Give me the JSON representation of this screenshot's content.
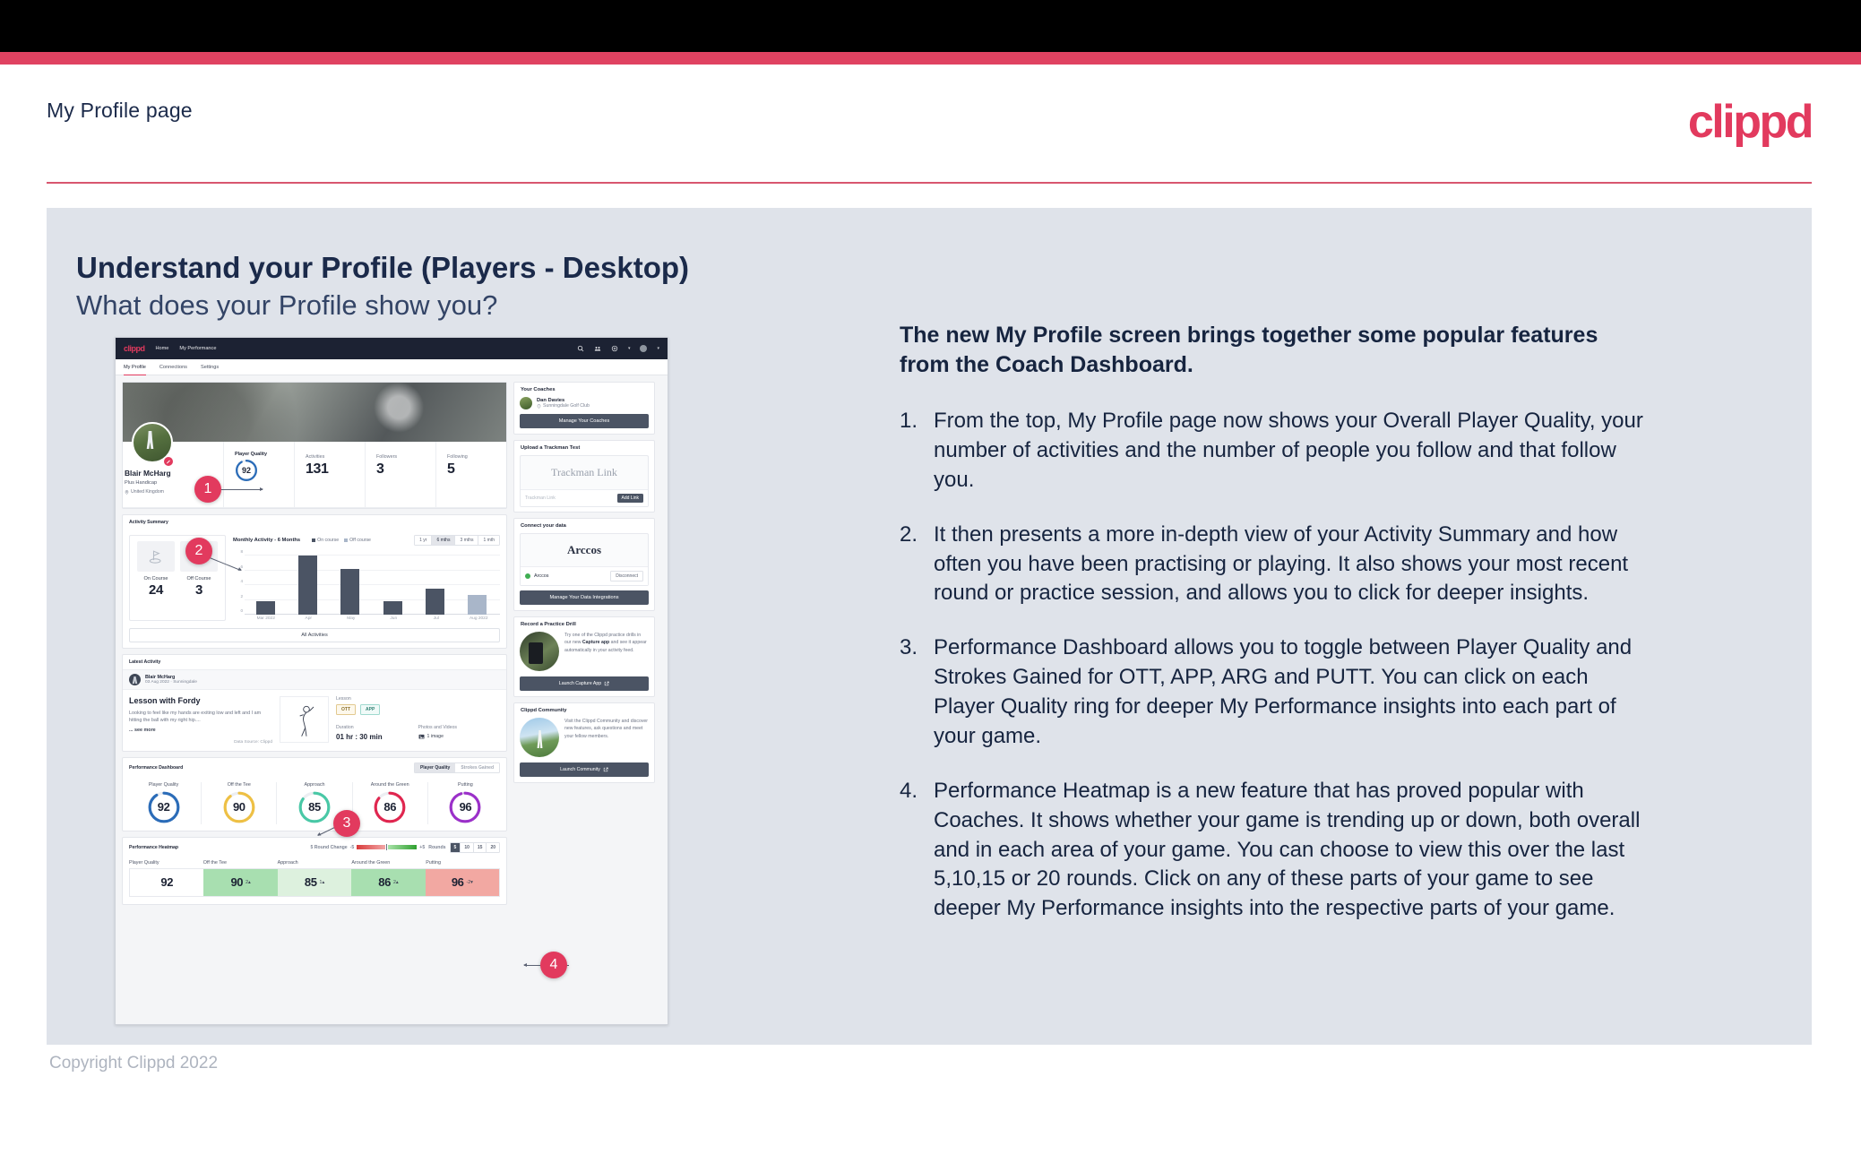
{
  "slide": {
    "kicker": "My Profile page",
    "brand": "clippd",
    "heading": "Understand your Profile (Players - Desktop)",
    "subheading": "What does your Profile show you?",
    "footer": "Copyright Clippd 2022",
    "accent_pink": "#e23a5e",
    "panel_bg": "#dfe3ea",
    "text_navy": "#16243f"
  },
  "copy": {
    "lead": "The new My Profile screen brings together some popular features from the Coach Dashboard.",
    "items": [
      {
        "num": "1.",
        "text": "From the top, My Profile page now shows your Overall Player Quality, your number of activities and the number of people you follow and that follow you."
      },
      {
        "num": "2.",
        "text": "It then presents a more in-depth view of your Activity Summary and how often you have been practising or playing. It also shows your most recent round or practice session, and allows you to click for deeper insights."
      },
      {
        "num": "3.",
        "text": "Performance Dashboard allows you to toggle between Player Quality and Strokes Gained for OTT, APP, ARG and PUTT. You can click on each Player Quality ring for deeper My Performance insights into each part of your game."
      },
      {
        "num": "4.",
        "text": "Performance Heatmap is a new feature that has proved popular with Coaches. It shows whether your game is trending up or down, both overall and in each area of your game. You can choose to view this over the last 5,10,15 or 20 rounds. Click on any of these parts of your game to see deeper My Performance insights into the respective parts of your game."
      }
    ]
  },
  "callouts": [
    {
      "label": "1"
    },
    {
      "label": "2"
    },
    {
      "label": "3"
    },
    {
      "label": "4"
    }
  ],
  "app": {
    "logo": "clippd",
    "nav": [
      {
        "label": "Home"
      },
      {
        "label": "My Performance"
      }
    ],
    "nav_icons": [
      "search-icon",
      "community-icon",
      "add-circle-icon",
      "avatar-icon"
    ],
    "tabs": [
      {
        "label": "My Profile",
        "active": true
      },
      {
        "label": "Connections",
        "active": false
      },
      {
        "label": "Settings",
        "active": false
      }
    ],
    "profile": {
      "name": "Blair McHarg",
      "handicap": "Plus Handicap",
      "location": "United Kingdom",
      "stats": [
        {
          "label": "Player Quality",
          "value": "92",
          "ring": true,
          "color": "#2b6cb8"
        },
        {
          "label": "Activities",
          "value": "131"
        },
        {
          "label": "Followers",
          "value": "3"
        },
        {
          "label": "Following",
          "value": "5"
        }
      ]
    },
    "activity_summary": {
      "title": "Activity Summary",
      "tiles": [
        {
          "label": "On Course",
          "value": "24",
          "icon": "golf-flag-icon"
        },
        {
          "label": "Off Course",
          "value": "3",
          "icon": "monitor-icon"
        }
      ],
      "all_activities_label": "All Activities",
      "range_options": [
        {
          "label": "1 yr",
          "active": false
        },
        {
          "label": "6 mths",
          "active": true
        },
        {
          "label": "3 mths",
          "active": false
        },
        {
          "label": "1 mth",
          "active": false
        }
      ],
      "legend": [
        {
          "label": "On course",
          "color": "#4b5464"
        },
        {
          "label": "Off course",
          "color": "#a9b6c9"
        }
      ]
    },
    "latest_activity": {
      "title": "Latest Activity",
      "user": "Blair McHarg",
      "meta": "03 Aug 2022 · Sunningdale",
      "activity_title": "Lesson with Fordy",
      "description": "Looking to feel like my hands are exiting low and left and I am hitting the ball with my right hip....",
      "see_more": "... see more",
      "data_source": "Data Source: Clippd",
      "type_label": "Lesson",
      "tags": [
        "OTT",
        "APP"
      ],
      "duration_label": "Duration",
      "duration_value": "01 hr : 30 min",
      "media_label": "Photos and Videos",
      "media_value": "1 image"
    },
    "performance_dashboard": {
      "title": "Performance Dashboard",
      "toggle": [
        {
          "label": "Player Quality",
          "active": true
        },
        {
          "label": "Strokes Gained",
          "active": false
        }
      ],
      "rings": [
        {
          "label": "Player Quality",
          "value": "92",
          "color": "#2b6cb8"
        },
        {
          "label": "Off the Tee",
          "value": "90",
          "color": "#eec044"
        },
        {
          "label": "Approach",
          "value": "85",
          "color": "#49c8a6"
        },
        {
          "label": "Around the Green",
          "value": "86",
          "color": "#e0264f"
        },
        {
          "label": "Putting",
          "value": "96",
          "color": "#9b30c9"
        }
      ]
    },
    "performance_heatmap": {
      "title": "Performance Heatmap",
      "change_label": "5 Round Change",
      "scale_min": "-5",
      "scale_max": "+5",
      "rounds_label": "Rounds",
      "rounds_options": [
        {
          "label": "5",
          "active": true
        },
        {
          "label": "10",
          "active": false
        },
        {
          "label": "15",
          "active": false
        },
        {
          "label": "20",
          "active": false
        }
      ],
      "cells": [
        {
          "label": "Player Quality",
          "value": "92",
          "delta": "",
          "dir": "",
          "bg": "#ffffff"
        },
        {
          "label": "Off the Tee",
          "value": "90",
          "delta": "2",
          "dir": "up",
          "bg": "#a8dfb0"
        },
        {
          "label": "Approach",
          "value": "85",
          "delta": "1",
          "dir": "up",
          "bg": "#ddf1de"
        },
        {
          "label": "Around the Green",
          "value": "86",
          "delta": "2",
          "dir": "up",
          "bg": "#a8dfb0"
        },
        {
          "label": "Putting",
          "value": "96",
          "delta": "-2",
          "dir": "down",
          "bg": "#f2a8a2"
        }
      ]
    },
    "sidebar": {
      "coaches": {
        "title": "Your Coaches",
        "coach_name": "Dan Davies",
        "coach_club": "Sunningdale Golf Club",
        "button": "Manage Your Coaches"
      },
      "trackman": {
        "title": "Upload a Trackman Test",
        "brand": "Trackman Link",
        "input_placeholder": "Trackman Link",
        "add_button": "Add Link"
      },
      "connect": {
        "title": "Connect your data",
        "brand": "Arccos",
        "provider": "Arccos",
        "disconnect": "Disconnect",
        "button": "Manage Your Data Integrations"
      },
      "practice": {
        "title": "Record a Practice Drill",
        "body_1": "Try one of the Clippd practice drills in our new ",
        "body_bold": "Capture app",
        "body_2": " and see it appear automatically in your activity feed.",
        "button": "Launch Capture App"
      },
      "community": {
        "title": "Clippd Community",
        "body": "Visit the Clippd Community and discover new features, ask questions and meet your fellow members.",
        "button": "Launch Community"
      }
    }
  },
  "chart_data": {
    "type": "bar",
    "title": "Monthly Activity - 6 Months",
    "categories": [
      "Mar 2022",
      "Apr",
      "May",
      "Jun",
      "Jul",
      "Aug 2022"
    ],
    "values": [
      2,
      9,
      7,
      2,
      4,
      3
    ],
    "bar_colors": [
      "#4b5464",
      "#4b5464",
      "#4b5464",
      "#4b5464",
      "#4b5464",
      "#a9b6c9"
    ],
    "xlabel": "",
    "ylabel": "",
    "ylim": [
      0,
      9
    ],
    "yticks": [
      "0",
      "2",
      "4",
      "6",
      "8"
    ],
    "grid": true,
    "legend": [
      "On course",
      "Off course"
    ],
    "legend_position": "top"
  }
}
